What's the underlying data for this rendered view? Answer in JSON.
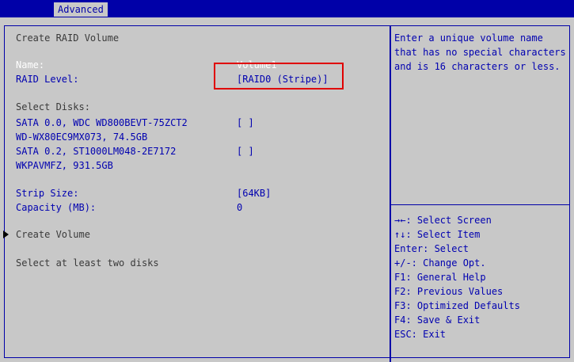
{
  "header": {
    "tab_label": "Advanced"
  },
  "main": {
    "title": "Create RAID Volume",
    "name_label": "Name:",
    "name_value": "Volume1",
    "raid_level_label": "RAID Level:",
    "raid_level_value": "[RAID0 (Stripe)]",
    "select_disks_label": "Select Disks:",
    "disks": [
      {
        "line1": "SATA 0.0, WDC WD800BEVT-75ZCT2",
        "line2": "WD-WX80EC9MX073, 74.5GB",
        "checkbox": "[ ]"
      },
      {
        "line1": "SATA 0.2, ST1000LM048-2E7172",
        "line2": "WKPAVMFZ, 931.5GB",
        "checkbox": "[ ]"
      }
    ],
    "strip_size_label": "Strip Size:",
    "strip_size_value": "[64KB]",
    "capacity_label": "Capacity (MB):",
    "capacity_value": "0",
    "create_volume_label": "Create Volume",
    "status_message": "Select at least two disks"
  },
  "help": {
    "lines": [
      "Enter a unique volume name",
      "that has no special characters",
      "and is 16 characters or less."
    ]
  },
  "keys": [
    "→←: Select Screen",
    "↑↓: Select Item",
    "Enter: Select",
    "+/-: Change Opt.",
    "F1: General Help",
    "F2: Previous Values",
    "F3: Optimized Defaults",
    "F4: Save & Exit",
    "ESC: Exit"
  ],
  "colors": {
    "background": "#c8c8c8",
    "accent": "#0000a8",
    "highlight_box": "#e00000"
  }
}
